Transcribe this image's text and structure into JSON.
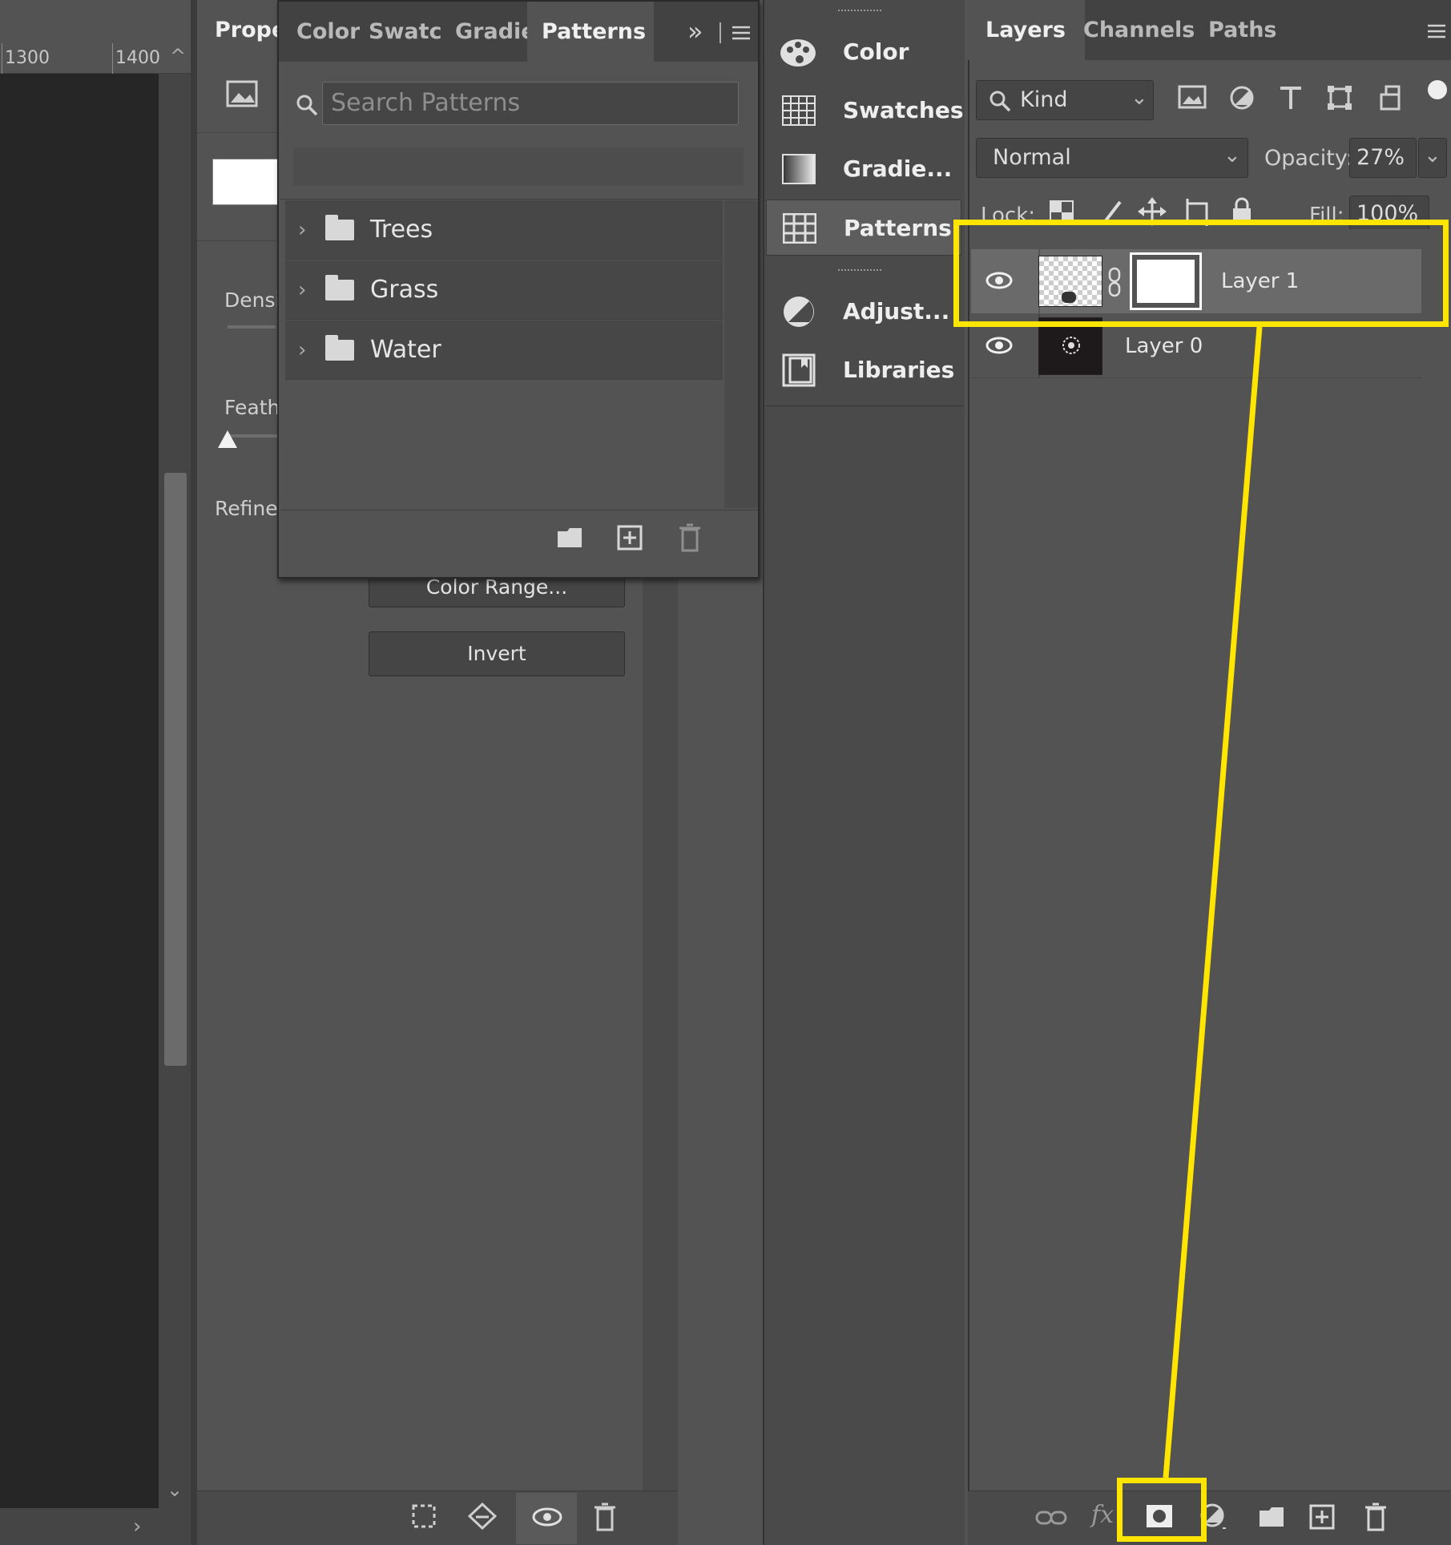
{
  "ruler": {
    "marks": [
      "1300",
      "1400"
    ]
  },
  "properties": {
    "tab_label": "Proper",
    "density_label": "Densi",
    "feather_label": "Feath",
    "refine_label": "Refine:",
    "color_range_button": "Color Range...",
    "invert_button": "Invert"
  },
  "patterns_panel": {
    "tabs": [
      "Color",
      "Swatch",
      "Gradie",
      "Patterns"
    ],
    "expand_glyph": "»",
    "search_placeholder": "Search Patterns",
    "folders": [
      "Trees",
      "Grass",
      "Water"
    ]
  },
  "dock": {
    "items": [
      "Color",
      "Swatches",
      "Gradie...",
      "Patterns",
      "Adjust...",
      "Libraries"
    ]
  },
  "layers_panel": {
    "tabs": [
      "Layers",
      "Channels",
      "Paths"
    ],
    "filter_label": "Kind",
    "blend_mode": "Normal",
    "opacity_label": "Opacity:",
    "opacity_value": "27%",
    "lock_label": "Lock:",
    "fill_label": "Fill:",
    "fill_value": "100%",
    "layers": [
      "Layer 1",
      "Layer 0"
    ],
    "fx_label": "fx"
  },
  "highlight_color": "#ffe500"
}
